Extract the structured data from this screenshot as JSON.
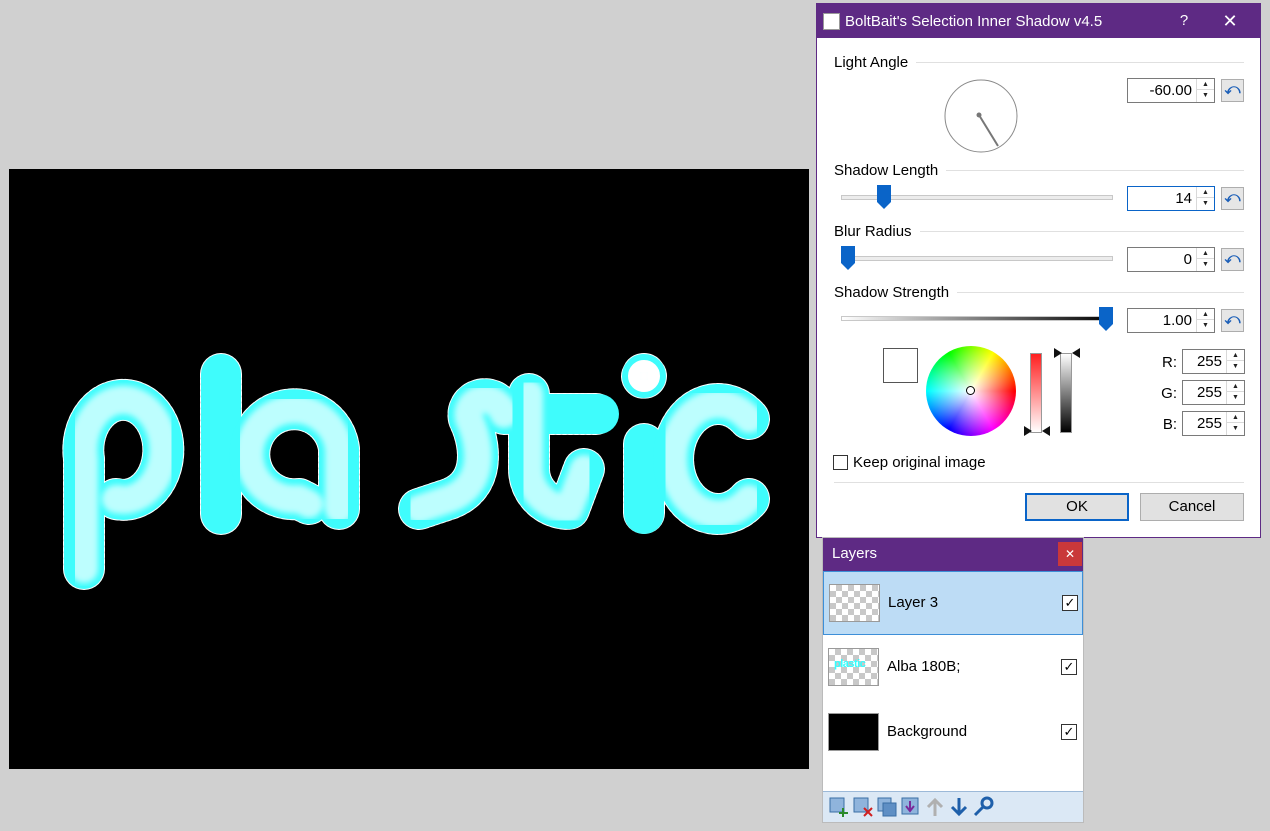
{
  "canvas": {
    "artwork_text": "plastic",
    "background_color": "#000000",
    "text_color": "#3ffcfc"
  },
  "dialog": {
    "title": "BoltBait's Selection Inner Shadow v4.5",
    "help_glyph": "?",
    "close_glyph": "✕",
    "light_angle": {
      "label": "Light Angle",
      "value": "-60.00"
    },
    "shadow_length": {
      "label": "Shadow Length",
      "value": "14",
      "fraction": 0.14
    },
    "blur_radius": {
      "label": "Blur Radius",
      "value": "0",
      "fraction": 0.0
    },
    "shadow_strength": {
      "label": "Shadow Strength",
      "value": "1.00",
      "fraction": 1.0
    },
    "color": {
      "r_label": "R:",
      "g_label": "G:",
      "b_label": "B:",
      "r": "255",
      "g": "255",
      "b": "255",
      "swatch": "#ffffff"
    },
    "keep_original": {
      "label": "Keep original image",
      "checked": false
    },
    "ok_label": "OK",
    "cancel_label": "Cancel",
    "reset_glyph": "⤺",
    "spin_up": "▲",
    "spin_down": "▼",
    "accent": "#5e2a84"
  },
  "layers": {
    "title": "Layers",
    "close_glyph": "✕",
    "check_glyph": "✓",
    "items": [
      {
        "name": "Layer 3",
        "visible": true,
        "selected": true
      },
      {
        "name": "Alba 180B;",
        "visible": true,
        "selected": false,
        "thumb_text": "plastic"
      },
      {
        "name": "Background",
        "visible": true,
        "selected": false
      }
    ],
    "toolbar_icons": [
      "add-layer-icon",
      "delete-layer-icon",
      "duplicate-layer-icon",
      "merge-layer-down-icon",
      "move-layer-up-icon",
      "move-layer-down-icon",
      "layer-properties-icon"
    ]
  }
}
